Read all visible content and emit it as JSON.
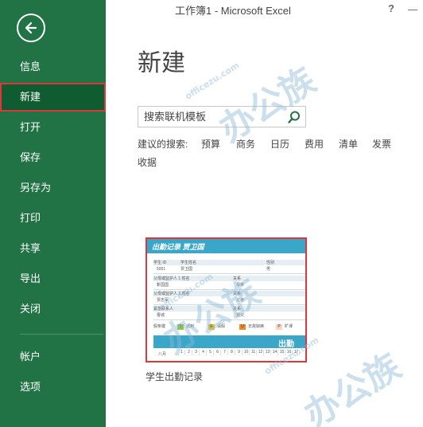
{
  "window": {
    "title": "工作簿1 - Microsoft Excel",
    "help": "?"
  },
  "sidebar": {
    "back_icon": "arrow-left-icon",
    "items": [
      {
        "label": "信息"
      },
      {
        "label": "新建"
      },
      {
        "label": "打开"
      },
      {
        "label": "保存"
      },
      {
        "label": "另存为"
      },
      {
        "label": "打印"
      },
      {
        "label": "共享"
      },
      {
        "label": "导出"
      },
      {
        "label": "关闭"
      },
      {
        "label": "帐户"
      },
      {
        "label": "选项"
      }
    ]
  },
  "main": {
    "title": "新建",
    "search": {
      "placeholder": "搜索联机模板",
      "icon": "search-icon"
    },
    "suggestions_label": "建议的搜索:",
    "suggestions": [
      "预算",
      "商务",
      "日历",
      "费用",
      "清单",
      "发票",
      "收据"
    ],
    "templates": [
      {
        "name": "学生出勤记录",
        "preview": {
          "title": "出勤记录  贾卫国",
          "fields": [
            {
              "label": "学生 ID",
              "value": "5001"
            },
            {
              "label": "学生姓名",
              "value": "贾卫国"
            },
            {
              "label": "性别",
              "value": "男"
            },
            {
              "label": "父母或监护人 1 姓名",
              "value": "靳国国"
            },
            {
              "label": "关系",
              "value": "母亲"
            },
            {
              "label": "父母或监护人 2 姓名",
              "value": "贾忠军"
            },
            {
              "label": "关系",
              "value": "父亲"
            },
            {
              "label": "紧急联系人",
              "value": "曹城"
            },
            {
              "label": "关系",
              "value": "祖父"
            }
          ],
          "legend": [
            {
              "code": "T",
              "label": "迟到",
              "color": "#8dc63f"
            },
            {
              "code": "E",
              "label": "请假",
              "color": "#f5c400"
            },
            {
              "code": "U",
              "label": "无故缺席",
              "color": "#f08a24"
            },
            {
              "code": "P",
              "label": "旷课",
              "color": "#f9d5c0"
            }
          ],
          "legend_title": "假条键",
          "banner": "出勤",
          "month": "八月",
          "days": [
            "1",
            "2",
            "3",
            "4",
            "5",
            "6",
            "7",
            "8",
            "9",
            "10",
            "11",
            "12",
            "13",
            "14",
            "15",
            "16",
            "17"
          ]
        }
      }
    ]
  },
  "colors": {
    "sidebar": "#217346",
    "accent_red": "#e0353b",
    "preview_header": "#3aa6c8"
  },
  "watermark": {
    "site": "officezu.com",
    "brand": "办公族"
  }
}
